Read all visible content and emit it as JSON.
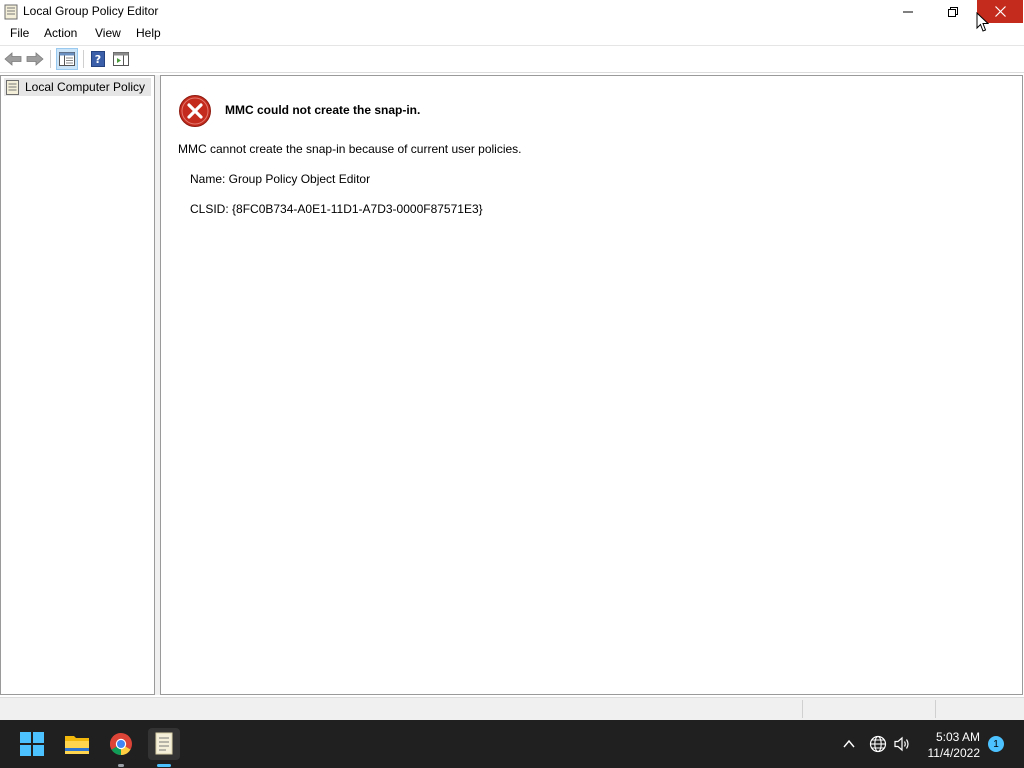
{
  "window": {
    "title": "Local Group Policy Editor"
  },
  "menu": [
    "File",
    "Action",
    "View",
    "Help"
  ],
  "tree": {
    "root_label": "Local Computer Policy"
  },
  "error": {
    "title": "MMC could not create the snap-in.",
    "description": "MMC cannot create the snap-in because of current user policies.",
    "name_line": "Name: Group Policy Object Editor",
    "clsid_line": "CLSID: {8FC0B734-A0E1-11D1-A7D3-0000F87571E3}"
  },
  "taskbar": {
    "time": "5:03 AM",
    "date": "11/4/2022",
    "notification_count": "1"
  },
  "colors": {
    "close_button": "#c42b1c",
    "error_red": "#c42b1c",
    "taskbar_bg": "#202020",
    "accent": "#4cc2ff"
  }
}
